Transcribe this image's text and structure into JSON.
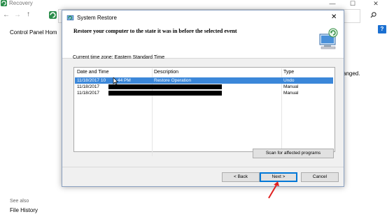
{
  "bg_window": {
    "title": "Recovery",
    "controls": [
      "—",
      "☐",
      "✕"
    ],
    "nav": {
      "back": "←",
      "forward": "→",
      "up": "↑"
    },
    "sidebar_home": "Control Panel Hom",
    "changed_fragment": "anged.",
    "see_also": "See also",
    "file_history": "File History",
    "help": "?"
  },
  "dialog": {
    "title": "System Restore",
    "close": "✕",
    "heading": "Restore your computer to the state it was in before the selected event",
    "timezone": "Current time zone: Eastern Standard Time",
    "columns": [
      "Date and Time",
      "Description",
      "Type"
    ],
    "rows": [
      {
        "date": "11/18/2017 10",
        "time_tail": "44 PM",
        "description": "Restore Operation",
        "type": "Undo",
        "selected": true
      },
      {
        "date": "11/18/2017",
        "description": "",
        "type": "Manual",
        "selected": false
      },
      {
        "date": "11/18/2017",
        "description": "",
        "type": "Manual",
        "selected": false
      }
    ],
    "scan_button": "Scan for affected programs",
    "back_button": "< Back",
    "next_button": "Next >",
    "cancel_button": "Cancel"
  },
  "colors": {
    "selection": "#3b87d9",
    "annotation_arrow": "#e02020",
    "focus": "#0078d7"
  }
}
